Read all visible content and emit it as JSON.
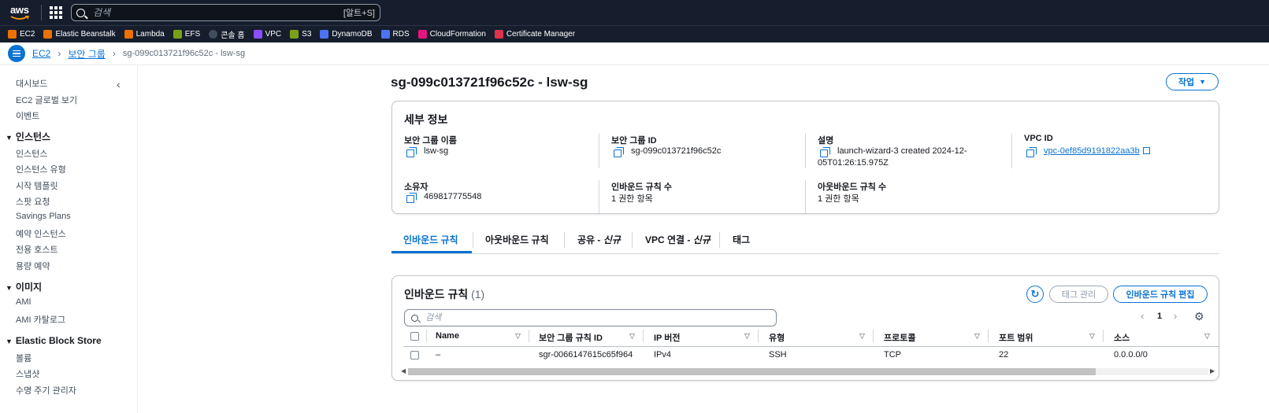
{
  "topnav": {
    "logo_text": "aws",
    "search_placeholder": "검색",
    "search_shortcut": "[알트+S]"
  },
  "favorites": [
    {
      "label": "EC2",
      "color": "#ed7100"
    },
    {
      "label": "Elastic Beanstalk",
      "color": "#ed7100"
    },
    {
      "label": "Lambda",
      "color": "#ed7100"
    },
    {
      "label": "EFS",
      "color": "#7aa116"
    },
    {
      "label": "콘솔 홈",
      "color": "#414d5c"
    },
    {
      "label": "VPC",
      "color": "#8c4fff"
    },
    {
      "label": "S3",
      "color": "#7aa116"
    },
    {
      "label": "DynamoDB",
      "color": "#4d72f3"
    },
    {
      "label": "RDS",
      "color": "#4d72f3"
    },
    {
      "label": "CloudFormation",
      "color": "#e7157b"
    },
    {
      "label": "Certificate Manager",
      "color": "#dd344c"
    }
  ],
  "breadcrumb": {
    "items": [
      "EC2",
      "보안 그룹"
    ],
    "current": "sg-099c013721f96c52c - lsw-sg"
  },
  "sidebar": {
    "top_items": [
      "대시보드",
      "EC2 글로벌 보기",
      "이벤트"
    ],
    "sections": [
      {
        "title": "인스턴스",
        "items": [
          "인스턴스",
          "인스턴스 유형",
          "시작 템플릿",
          "스팟 요청",
          "Savings Plans",
          "예약 인스턴스",
          "전용 호스트",
          "용량 예약"
        ]
      },
      {
        "title": "이미지",
        "items": [
          "AMI",
          "AMI 카탈로그"
        ]
      },
      {
        "title": "Elastic Block Store",
        "items": [
          "볼륨",
          "스냅샷",
          "수명 주기 관리자"
        ]
      }
    ]
  },
  "page": {
    "title": "sg-099c013721f96c52c - lsw-sg",
    "action_label": "작업"
  },
  "details": {
    "title": "세부 정보",
    "sg_name_label": "보안 그룹 이름",
    "sg_name": "lsw-sg",
    "sg_id_label": "보안 그룹 ID",
    "sg_id": "sg-099c013721f96c52c",
    "desc_label": "설명",
    "desc_line1": "launch-wizard-3 created 2024-12-",
    "desc_line2": "05T01:26:15.975Z",
    "vpc_label": "VPC ID",
    "vpc_id": "vpc-0ef85d9191822aa3b",
    "owner_label": "소유자",
    "owner": "469817775548",
    "inbound_count_label": "인바운드 규칙 수",
    "inbound_count": "1 권한 항목",
    "outbound_count_label": "아웃바운드 규칙 수",
    "outbound_count": "1 권한 항목"
  },
  "tabs": {
    "inbound": "인바운드 규칙",
    "outbound": "아웃바운드 규칙",
    "share": "공유 - ",
    "share_tag": "신규",
    "vpc": "VPC 연결 - ",
    "vpc_tag": "신규",
    "tags": "태그"
  },
  "rules": {
    "title": "인바운드 규칙",
    "count": "(1)",
    "manage_tags": "태그 관리",
    "edit_rules": "인바운드 규칙 편집",
    "search_placeholder": "검색",
    "page_number": "1",
    "columns": [
      "Name",
      "보안 그룹 규칙 ID",
      "IP 버전",
      "유형",
      "프로토콜",
      "포트 범위",
      "소스"
    ],
    "rows": [
      [
        "–",
        "sgr-0066147615c65f964",
        "IPv4",
        "SSH",
        "TCP",
        "22",
        "0.0.0.0/0"
      ]
    ]
  }
}
